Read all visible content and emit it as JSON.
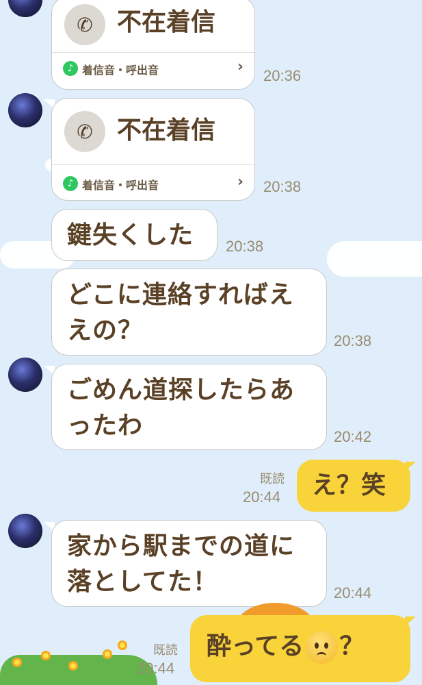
{
  "colors": {
    "background": "#dfeefa",
    "incoming_bubble": "#ffffff",
    "outgoing_bubble": "#f8d33a",
    "text": "#5a4126",
    "time": "#9a8b6f",
    "music_icon": "#2ec760"
  },
  "messages": [
    {
      "type": "missed_call",
      "title": "不在着信",
      "sub": "着信音・呼出音",
      "time": "20:36"
    },
    {
      "type": "missed_call",
      "title": "不在着信",
      "sub": "着信音・呼出音",
      "time": "20:38"
    },
    {
      "type": "text",
      "text": "鍵失くした",
      "time": "20:38"
    },
    {
      "type": "text",
      "line1": "どこに連絡すればえ",
      "line2": "えの？",
      "time": "20:38"
    },
    {
      "type": "text",
      "line1": "ごめん道探したらあ",
      "line2": "ったわ",
      "time": "20:42"
    },
    {
      "type": "outgoing",
      "text": "え？笑",
      "read": "既読",
      "time": "20:44"
    },
    {
      "type": "text",
      "line1": "家から駅までの道に",
      "line2": "落としてた！",
      "time": "20:44"
    },
    {
      "type": "outgoing",
      "text_before": "酔ってる",
      "emoji": "worried-face",
      "text_after": "？",
      "read": "既読",
      "time": "20:44"
    }
  ],
  "icons": {
    "phone": "phone-icon",
    "music": "music-note-icon",
    "chevron": "chevron-right-icon"
  }
}
